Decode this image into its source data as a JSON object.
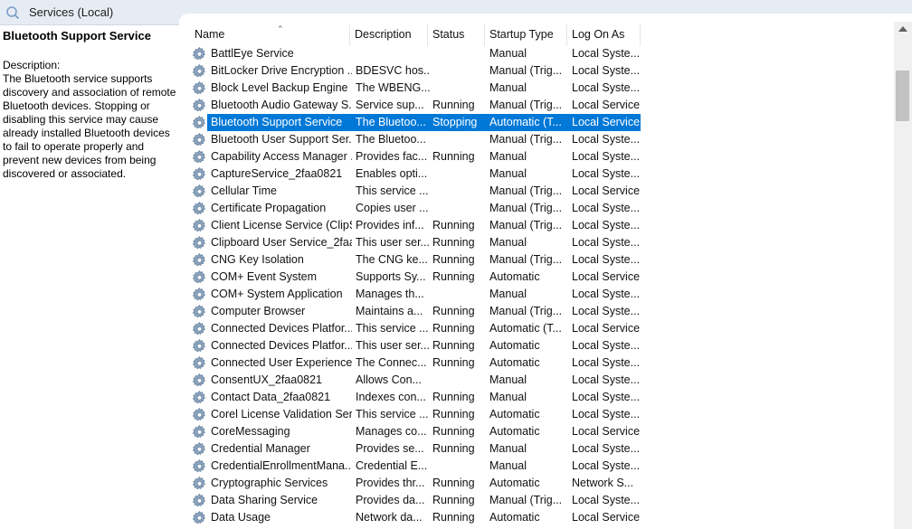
{
  "window": {
    "title": "Services (Local)",
    "icon": "search-icon"
  },
  "details": {
    "title": "Bluetooth Support Service",
    "description_label": "Description:",
    "description": "The Bluetooth service supports discovery and association of remote Bluetooth devices.  Stopping or disabling this service may cause already installed Bluetooth devices to fail to operate properly and prevent new devices from being discovered or associated."
  },
  "columns": [
    "Name",
    "Description",
    "Status",
    "Startup Type",
    "Log On As"
  ],
  "sort": {
    "column": "Name",
    "direction": "ascending"
  },
  "selected_row": 4,
  "colors": {
    "selection": "#0078d7",
    "title_bar": "#e6ecf4",
    "selected_text": "#ffffff"
  },
  "services": [
    {
      "name": "BattlEye Service",
      "description": "",
      "status": "",
      "startup": "Manual",
      "logon": "Local Syste..."
    },
    {
      "name": "BitLocker Drive Encryption ...",
      "description": "BDESVC hos...",
      "status": "",
      "startup": "Manual (Trig...",
      "logon": "Local Syste..."
    },
    {
      "name": "Block Level Backup Engine ...",
      "description": "The WBENG...",
      "status": "",
      "startup": "Manual",
      "logon": "Local Syste..."
    },
    {
      "name": "Bluetooth Audio Gateway S...",
      "description": "Service sup...",
      "status": "Running",
      "startup": "Manual (Trig...",
      "logon": "Local Service"
    },
    {
      "name": "Bluetooth Support Service",
      "description": "The Bluetoo...",
      "status": "Stopping",
      "startup": "Automatic (T...",
      "logon": "Local Service"
    },
    {
      "name": "Bluetooth User Support Ser...",
      "description": "The Bluetoo...",
      "status": "",
      "startup": "Manual (Trig...",
      "logon": "Local Syste..."
    },
    {
      "name": "Capability Access Manager ...",
      "description": "Provides fac...",
      "status": "Running",
      "startup": "Manual",
      "logon": "Local Syste..."
    },
    {
      "name": "CaptureService_2faa0821",
      "description": "Enables opti...",
      "status": "",
      "startup": "Manual",
      "logon": "Local Syste..."
    },
    {
      "name": "Cellular Time",
      "description": "This service ...",
      "status": "",
      "startup": "Manual (Trig...",
      "logon": "Local Service"
    },
    {
      "name": "Certificate Propagation",
      "description": "Copies user ...",
      "status": "",
      "startup": "Manual (Trig...",
      "logon": "Local Syste..."
    },
    {
      "name": "Client License Service (ClipS...",
      "description": "Provides inf...",
      "status": "Running",
      "startup": "Manual (Trig...",
      "logon": "Local Syste..."
    },
    {
      "name": "Clipboard User Service_2faa...",
      "description": "This user ser...",
      "status": "Running",
      "startup": "Manual",
      "logon": "Local Syste..."
    },
    {
      "name": "CNG Key Isolation",
      "description": "The CNG ke...",
      "status": "Running",
      "startup": "Manual (Trig...",
      "logon": "Local Syste..."
    },
    {
      "name": "COM+ Event System",
      "description": "Supports Sy...",
      "status": "Running",
      "startup": "Automatic",
      "logon": "Local Service"
    },
    {
      "name": "COM+ System Application",
      "description": "Manages th...",
      "status": "",
      "startup": "Manual",
      "logon": "Local Syste..."
    },
    {
      "name": "Computer Browser",
      "description": "Maintains a...",
      "status": "Running",
      "startup": "Manual (Trig...",
      "logon": "Local Syste..."
    },
    {
      "name": "Connected Devices Platfor...",
      "description": "This service ...",
      "status": "Running",
      "startup": "Automatic (T...",
      "logon": "Local Service"
    },
    {
      "name": "Connected Devices Platfor...",
      "description": "This user ser...",
      "status": "Running",
      "startup": "Automatic",
      "logon": "Local Syste..."
    },
    {
      "name": "Connected User Experience...",
      "description": "The Connec...",
      "status": "Running",
      "startup": "Automatic",
      "logon": "Local Syste..."
    },
    {
      "name": "ConsentUX_2faa0821",
      "description": "Allows Con...",
      "status": "",
      "startup": "Manual",
      "logon": "Local Syste..."
    },
    {
      "name": "Contact Data_2faa0821",
      "description": "Indexes con...",
      "status": "Running",
      "startup": "Manual",
      "logon": "Local Syste..."
    },
    {
      "name": "Corel License Validation Ser...",
      "description": "This service ...",
      "status": "Running",
      "startup": "Automatic",
      "logon": "Local Syste..."
    },
    {
      "name": "CoreMessaging",
      "description": "Manages co...",
      "status": "Running",
      "startup": "Automatic",
      "logon": "Local Service"
    },
    {
      "name": "Credential Manager",
      "description": "Provides se...",
      "status": "Running",
      "startup": "Manual",
      "logon": "Local Syste..."
    },
    {
      "name": "CredentialEnrollmentMana...",
      "description": "Credential E...",
      "status": "",
      "startup": "Manual",
      "logon": "Local Syste..."
    },
    {
      "name": "Cryptographic Services",
      "description": "Provides thr...",
      "status": "Running",
      "startup": "Automatic",
      "logon": "Network S..."
    },
    {
      "name": "Data Sharing Service",
      "description": "Provides da...",
      "status": "Running",
      "startup": "Manual (Trig...",
      "logon": "Local Syste..."
    },
    {
      "name": "Data Usage",
      "description": "Network da...",
      "status": "Running",
      "startup": "Automatic",
      "logon": "Local Service"
    }
  ]
}
